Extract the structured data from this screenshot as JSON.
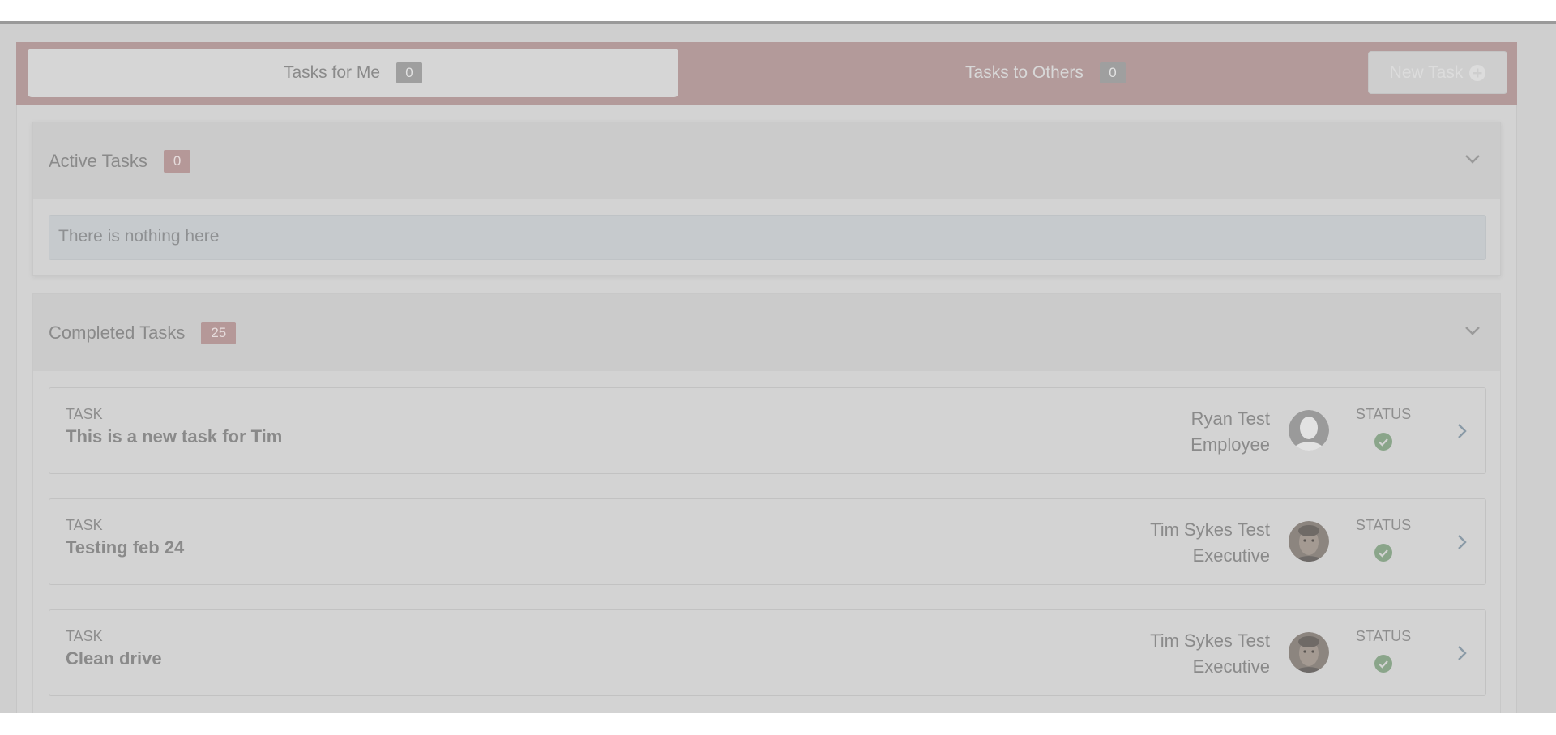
{
  "tabs": {
    "for_me": {
      "label": "Tasks for Me",
      "count": "0"
    },
    "to_others": {
      "label": "Tasks to Others",
      "count": "0"
    },
    "new_task_label": "New Task"
  },
  "icons": {
    "new_task": "plus-circle-icon",
    "section_toggle": "chevron-down-icon",
    "row_open": "chevron-right-icon",
    "status": "check-circle-icon",
    "avatar_placeholder": "user-placeholder-icon"
  },
  "active_section": {
    "title": "Active Tasks",
    "count": "0",
    "empty_message": "There is nothing here"
  },
  "completed_section": {
    "title": "Completed Tasks",
    "count": "25",
    "tasks": [
      {
        "label": "TASK",
        "title": "This is a new task for Tim",
        "person_name": "Ryan Test",
        "person_role": "Employee",
        "status_label": "STATUS"
      },
      {
        "label": "TASK",
        "title": "Testing feb 24",
        "person_name": "Tim Sykes Test",
        "person_role": "Executive",
        "status_label": "STATUS"
      },
      {
        "label": "TASK",
        "title": "Clean drive",
        "person_name": "Tim Sykes Test",
        "person_role": "Executive",
        "status_label": "STATUS"
      }
    ]
  },
  "colors": {
    "tab_bar": "#b39a9a",
    "count_badge_red": "#b59898",
    "status_green": "#8aa58a",
    "empty_notice": "#c6cacd"
  }
}
